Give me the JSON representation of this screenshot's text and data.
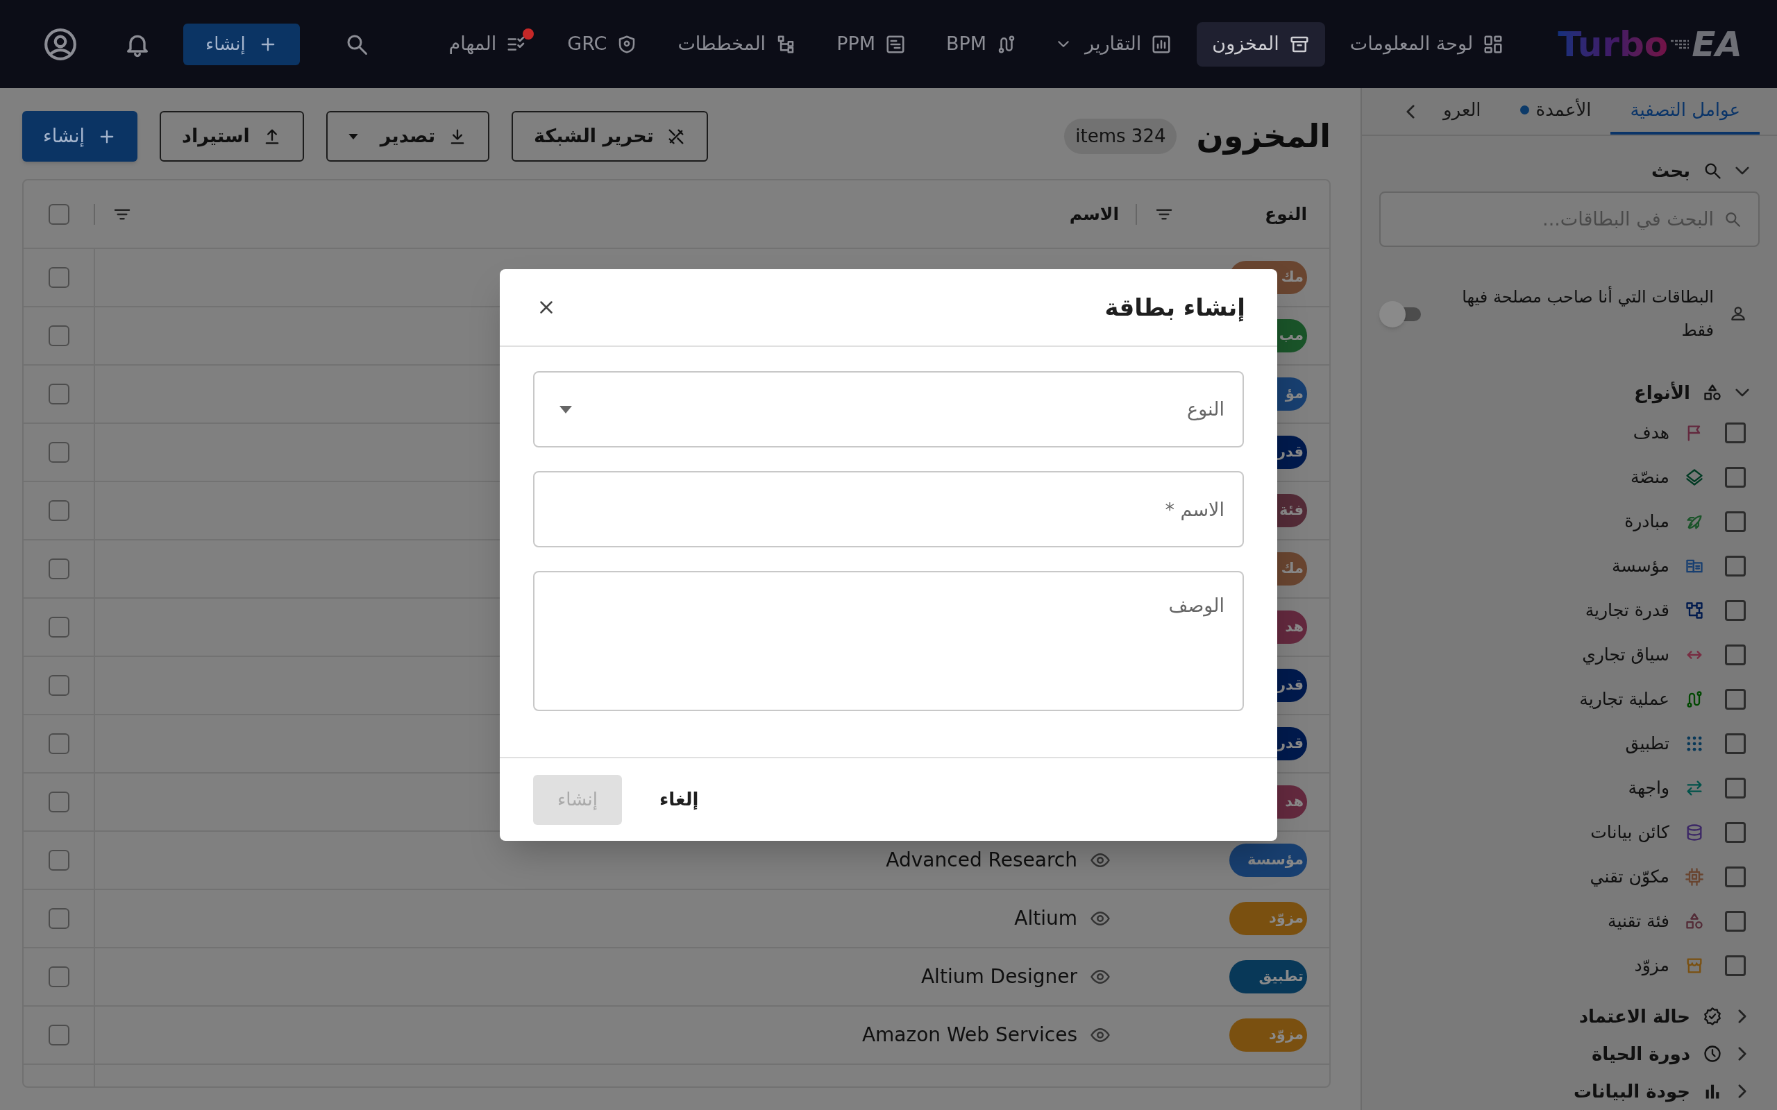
{
  "app": {
    "logo": {
      "word": "Turbo",
      "mark": "EA"
    }
  },
  "nav": {
    "items": [
      {
        "label": "لوحة المعلومات",
        "selected": false,
        "has_menu": false,
        "notification": false
      },
      {
        "label": "المخزون",
        "selected": true,
        "has_menu": false,
        "notification": false
      },
      {
        "label": "التقارير",
        "selected": false,
        "has_menu": true,
        "notification": false
      },
      {
        "label": "BPM",
        "selected": false,
        "has_menu": false,
        "notification": false
      },
      {
        "label": "PPM",
        "selected": false,
        "has_menu": false,
        "notification": false
      },
      {
        "label": "المخططات",
        "selected": false,
        "has_menu": false,
        "notification": false
      },
      {
        "label": "GRC",
        "selected": false,
        "has_menu": false,
        "notification": false
      },
      {
        "label": "المهام",
        "selected": false,
        "has_menu": false,
        "notification": true
      }
    ],
    "create_button": "إنشاء"
  },
  "sidebar": {
    "tabs": [
      {
        "label": "عوامل التصفية",
        "selected": true,
        "indicator": false
      },
      {
        "label": "الأعمدة",
        "selected": false,
        "indicator": true
      },
      {
        "label": "العرو",
        "selected": false,
        "indicator": false
      }
    ],
    "search": {
      "title": "بحث",
      "expanded": true,
      "placeholder": "البحث في البطاقات..."
    },
    "stakeholder_toggle": {
      "label": "البطاقات التي أنا صاحب مصلحة فيها فقط",
      "on": false
    },
    "types": {
      "title": "الأنواع",
      "expanded": true,
      "items": [
        {
          "label": "هدف",
          "checked": false,
          "color": "#63293e"
        },
        {
          "label": "منصّة",
          "checked": false,
          "color": "#013a23"
        },
        {
          "label": "مبادرة",
          "checked": false,
          "color": "#1a5429"
        },
        {
          "label": "مؤسسة",
          "checked": false,
          "color": "#183f70"
        },
        {
          "label": "قدرة تجارية",
          "checked": false,
          "color": "#001a4d"
        },
        {
          "label": "سياق تجاري",
          "checked": false,
          "color": "#782d42"
        },
        {
          "label": "عملية تجارية",
          "checked": false,
          "color": "#014800"
        },
        {
          "label": "تطبيق",
          "checked": false,
          "color": "#083858"
        },
        {
          "label": "واجهة",
          "checked": false,
          "color": "#01524a"
        },
        {
          "label": "كائن بيانات",
          "checked": false,
          "color": "#3c2866"
        },
        {
          "label": "مكوّن تقني",
          "checked": false,
          "color": "#694530"
        },
        {
          "label": "فئة تقنية",
          "checked": false,
          "color": "#532b37"
        },
        {
          "label": "مزوّد",
          "checked": false,
          "color": "#7a5010"
        }
      ]
    },
    "sections": [
      {
        "title": "حالة الاعتماد",
        "expanded": false
      },
      {
        "title": "دورة الحياة",
        "expanded": false
      },
      {
        "title": "جودة البيانات",
        "expanded": false
      }
    ]
  },
  "page": {
    "title": "المخزون",
    "count": "items 324",
    "toolbar": [
      {
        "label": "تحرير الشبكة",
        "kind": "outlined"
      },
      {
        "label": "تصدير",
        "kind": "menu"
      },
      {
        "label": "استيراد",
        "kind": "outlined"
      },
      {
        "label": "إنشاء",
        "kind": "primary"
      }
    ]
  },
  "table": {
    "columns": [
      "النوع",
      "الاسم"
    ],
    "select_all_checked": false,
    "rows": [
      {
        "type": "مك",
        "color": "#694530",
        "checked": false
      },
      {
        "type": "مب",
        "color": "#1a5429",
        "checked": false
      },
      {
        "type": "مؤ",
        "color": "#183f70",
        "checked": false
      },
      {
        "type": "قدر",
        "color": "#001a4d",
        "checked": false
      },
      {
        "type": "فئة",
        "color": "#532b37",
        "checked": false
      },
      {
        "type": "مك",
        "color": "#694530",
        "checked": false
      },
      {
        "type": "هد",
        "color": "#63293e",
        "checked": false
      },
      {
        "type": "قدر",
        "color": "#001a4d",
        "checked": false
      },
      {
        "type": "قدر",
        "color": "#001a4d",
        "checked": false
      },
      {
        "type": "هد",
        "color": "#63293e",
        "checked": false
      },
      {
        "type": "مؤسسة",
        "name": "Advanced Research",
        "color": "#183f70",
        "checked": false
      },
      {
        "type": "مزوّد",
        "name": "Altium",
        "color": "#7a5010",
        "checked": false
      },
      {
        "type": "تطبيق",
        "name": "Altium Designer",
        "color": "#083858",
        "checked": false
      },
      {
        "type": "مزوّد",
        "name": "Amazon Web Services",
        "color": "#7a5010",
        "checked": false
      }
    ]
  },
  "modal": {
    "title": "إنشاء بطاقة",
    "fields": [
      {
        "kind": "select",
        "placeholder": "النوع"
      },
      {
        "kind": "input",
        "placeholder": "الاسم *"
      },
      {
        "kind": "textarea",
        "placeholder": "الوصف"
      }
    ],
    "buttons": [
      {
        "label": "إلغاء",
        "kind": "text",
        "disabled": false
      },
      {
        "label": "إنشاء",
        "kind": "contained",
        "disabled": true
      }
    ]
  }
}
